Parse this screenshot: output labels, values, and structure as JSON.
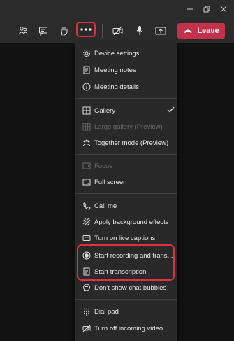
{
  "toolbar": {
    "leave_label": "Leave"
  },
  "menu": {
    "items": [
      {
        "label": "Device settings",
        "icon": "gear-icon"
      },
      {
        "label": "Meeting notes",
        "icon": "notes-icon"
      },
      {
        "label": "Meeting details",
        "icon": "info-icon"
      },
      {
        "label": "Gallery",
        "icon": "gallery-icon",
        "checked": true
      },
      {
        "label": "Large gallery (Preview)",
        "icon": "large-gallery-icon",
        "disabled": true
      },
      {
        "label": "Together mode (Preview)",
        "icon": "together-mode-icon"
      },
      {
        "label": "Focus",
        "icon": "focus-icon",
        "disabled": true
      },
      {
        "label": "Full screen",
        "icon": "fullscreen-icon"
      },
      {
        "label": "Call me",
        "icon": "phone-icon"
      },
      {
        "label": "Apply background effects",
        "icon": "background-effects-icon"
      },
      {
        "label": "Turn on live captions",
        "icon": "captions-icon"
      },
      {
        "label": "Start recording and trans...",
        "icon": "record-icon"
      },
      {
        "label": "Start transcription",
        "icon": "transcription-icon"
      },
      {
        "label": "Don't show chat bubbles",
        "icon": "chat-bubble-icon"
      },
      {
        "label": "Dial pad",
        "icon": "dialpad-icon"
      },
      {
        "label": "Turn off incoming video",
        "icon": "video-off-icon"
      }
    ]
  },
  "colors": {
    "accent_red": "#c4314b",
    "highlight": "#e03040",
    "menu_bg": "#292929"
  }
}
